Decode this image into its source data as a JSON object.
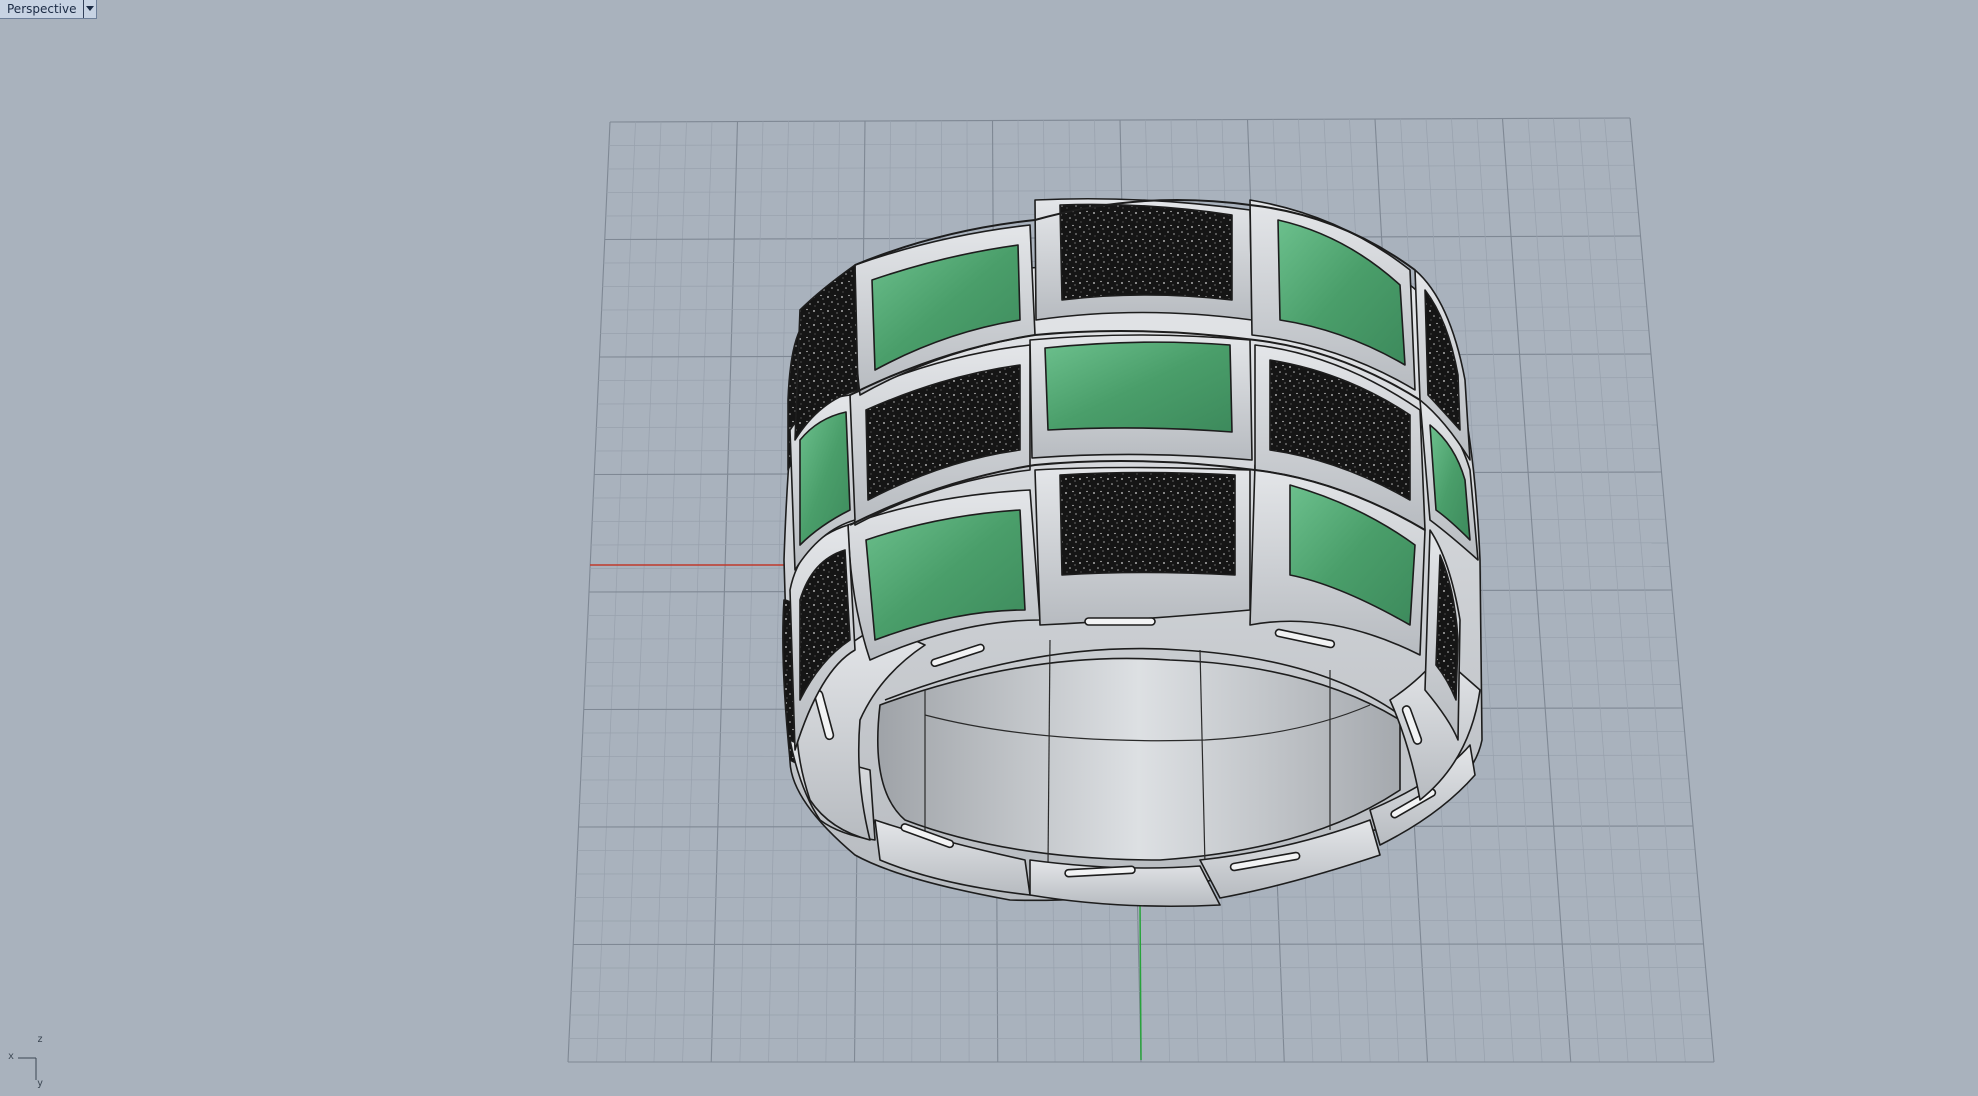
{
  "viewport": {
    "name": "Perspective",
    "menu_icon": "dropdown-arrow-icon"
  },
  "axis_widget": {
    "x_label": "x",
    "y_label": "y",
    "z_label": "z"
  },
  "colors": {
    "background": "#a9b2bd",
    "grid_minor": "#98a1ad",
    "grid_major": "#7f8894",
    "x_axis": "#c0392b",
    "y_axis": "#27a33a",
    "metal": "#cfd2d6",
    "gem_green": "#4fae76",
    "pave_black": "#151515"
  }
}
